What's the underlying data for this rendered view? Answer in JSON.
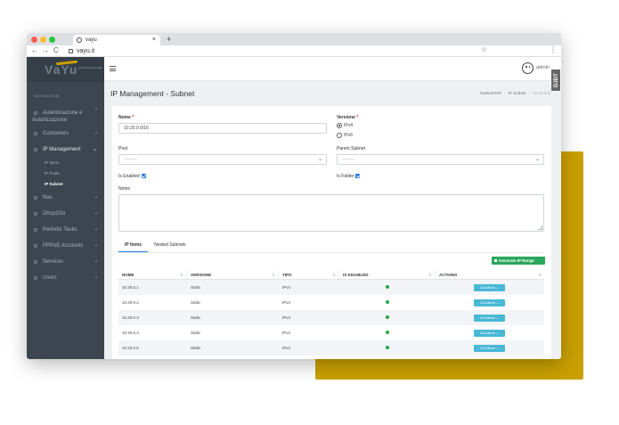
{
  "browser": {
    "tab_title": "vayu",
    "tab_close": "×",
    "new_tab": "+",
    "url": "vayu.it",
    "back": "←",
    "forward": "→",
    "reload": "C",
    "star": "☆",
    "menu": "⋮"
  },
  "sidebar": {
    "brand": "VaYu",
    "brand_tag": "RADIUS MANAGER",
    "nav_label": "NAVIGATION",
    "items": [
      {
        "label": "Autenticazione e Autorizzazione",
        "chev": "›"
      },
      {
        "label": "Customers",
        "chev": "›"
      },
      {
        "label": "IP Management",
        "chev": "⌄"
      },
      {
        "label": "Nas",
        "chev": "›"
      },
      {
        "label": "Dhcp2Go",
        "chev": "›"
      },
      {
        "label": "Periodic Tasks",
        "chev": "›"
      },
      {
        "label": "PPPoE Accounts",
        "chev": "›"
      },
      {
        "label": "Services",
        "chev": "›"
      },
      {
        "label": "Users",
        "chev": "›"
      }
    ],
    "subitems": [
      "IP Items",
      "IP Pools",
      "IP Subnet"
    ]
  },
  "topbar": {
    "user": "admin",
    "ribbon": "DJDT"
  },
  "page": {
    "title": "IP Management - Subnet",
    "breadcrumbs": [
      "RadiusFISP",
      "IP Subnet",
      "10.20.0.0/"
    ]
  },
  "form": {
    "nome_label": "Nome",
    "required_mark": "*",
    "nome_value": "10.20.0.0/16",
    "versione_label": "Versione",
    "versione_options": [
      "IPv4",
      "IPv6"
    ],
    "pool_label": "Pool",
    "pool_value": "---------",
    "parent_label": "Parent Subnet",
    "parent_value": "---------",
    "caret": "⌄",
    "enabled_label": "Is Enabled",
    "folder_label": "Is Folder",
    "notes_label": "Notes"
  },
  "tabs": [
    "IP Items",
    "Nested Subnets"
  ],
  "generate_button": "Generate IP Range",
  "table": {
    "headers": [
      "NOME",
      "VERSIONE",
      "TIPO",
      "IS DISABLED",
      "ACTIONS"
    ],
    "sort_icon": "⇅",
    "action_label": "☑ Actions ⌄",
    "rows": [
      {
        "nome": "10.20.0.1",
        "versione": "Static",
        "tipo": "IPv4"
      },
      {
        "nome": "10.20.0.2",
        "versione": "Static",
        "tipo": "IPv4"
      },
      {
        "nome": "10.20.0.3",
        "versione": "Static",
        "tipo": "IPv4"
      },
      {
        "nome": "10.20.0.4",
        "versione": "Static",
        "tipo": "IPv4"
      },
      {
        "nome": "10.20.0.5",
        "versione": "Static",
        "tipo": "IPv4"
      }
    ]
  },
  "colors": {
    "accent_gold": "#c9a000",
    "sidebar_bg": "#3d4650",
    "success": "#2aa65c",
    "info": "#48b8d6"
  }
}
